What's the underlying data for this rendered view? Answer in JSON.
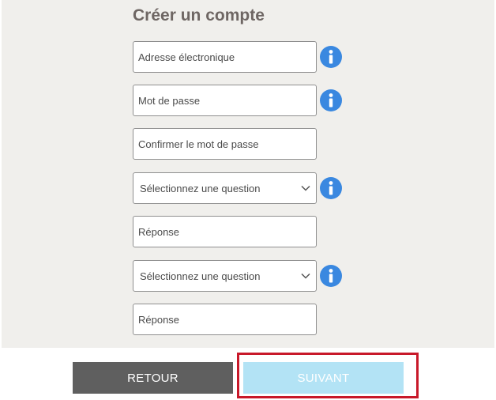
{
  "form": {
    "title": "Créer un compte",
    "email_placeholder": "Adresse électronique",
    "password_placeholder": "Mot de passe",
    "confirm_password_placeholder": "Confirmer le mot de passe",
    "question1_selected": "Sélectionnez une question",
    "answer1_placeholder": "Réponse",
    "question2_selected": "Sélectionnez une question",
    "answer2_placeholder": "Réponse"
  },
  "buttons": {
    "back_label": "RETOUR",
    "next_label": "SUIVANT"
  },
  "icons": {
    "info": "info-icon",
    "chevron": "chevron-down-icon"
  },
  "colors": {
    "panel_bg": "#f0efec",
    "info_blue": "#3a88e0",
    "back_button": "#5f5f5f",
    "next_button": "#b3e3f5",
    "highlight": "#c8192a"
  }
}
